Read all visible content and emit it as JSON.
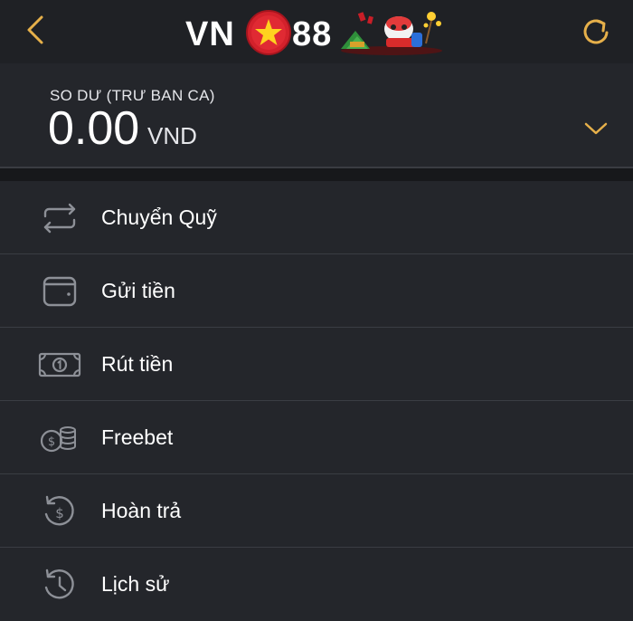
{
  "header": {
    "logo_text_left": "VN",
    "logo_text_right": "88",
    "back_icon": "chevron-left-icon",
    "refresh_icon": "refresh-icon",
    "accent_color": "#e6b04a"
  },
  "balance": {
    "label": "SO DƯ (TRƯ BAN CA)",
    "amount": "0.00",
    "currency": "VND",
    "toggle_icon": "chevron-down-icon"
  },
  "menu": {
    "items": [
      {
        "label": "Chuyển Quỹ",
        "icon": "transfer-icon"
      },
      {
        "label": "Gửi tiền",
        "icon": "wallet-icon"
      },
      {
        "label": "Rút tiền",
        "icon": "banknote-icon"
      },
      {
        "label": "Freebet",
        "icon": "coins-icon"
      },
      {
        "label": "Hoàn trả",
        "icon": "refund-icon"
      },
      {
        "label": "Lịch sử",
        "icon": "history-icon"
      }
    ]
  }
}
